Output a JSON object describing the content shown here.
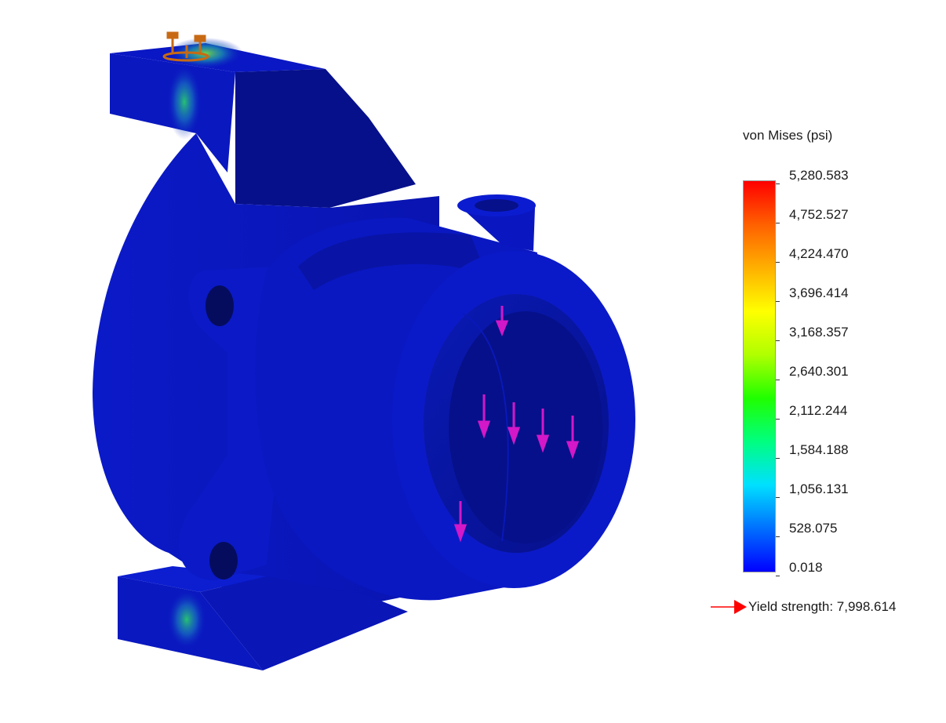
{
  "legend": {
    "title": "von Mises (psi)",
    "ticks": [
      "5,280.583",
      "4,752.527",
      "4,224.470",
      "3,696.414",
      "3,168.357",
      "2,640.301",
      "2,112.244",
      "1,584.188",
      "1,056.131",
      "528.075",
      "0.018"
    ],
    "yield_label": "Yield strength: 7,998.614"
  },
  "colors": {
    "part_base": "#0a17c4",
    "part_dark": "#06108a",
    "part_shadow": "#050c5e",
    "highlight_green": "#2bd36a",
    "load_arrows": "#d218c8",
    "fixture": "#c86a14",
    "yield_arrow": "#ff0000",
    "scale": [
      "#0000ff",
      "#0070ff",
      "#00e0ff",
      "#00ff80",
      "#20ff00",
      "#b0ff00",
      "#ffff00",
      "#ffb000",
      "#ff6000",
      "#ff0000"
    ]
  }
}
